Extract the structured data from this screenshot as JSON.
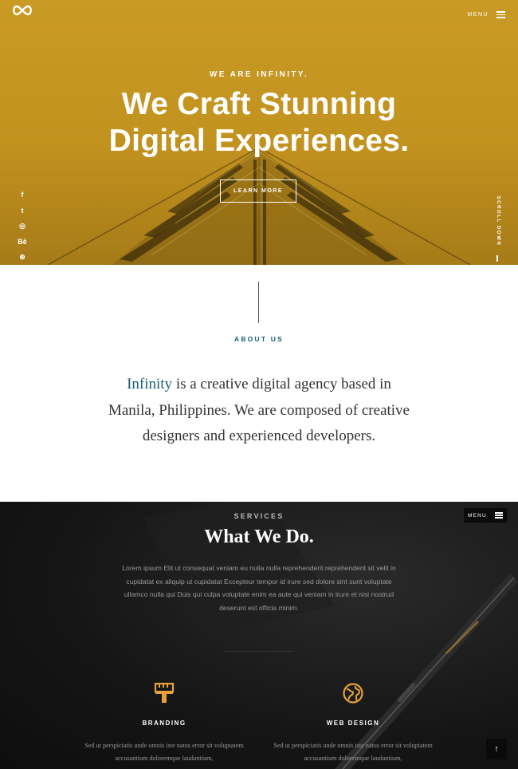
{
  "header": {
    "menu_label": "MENU",
    "logo_icon": "infinity-icon"
  },
  "hero": {
    "eyebrow": "WE ARE INFINITY.",
    "headline_line1": "We Craft Stunning",
    "headline_line2": "Digital Experiences.",
    "cta_label": "LEARN MORE",
    "scroll_label": "SCROLL DOWN",
    "social": [
      {
        "icon": "facebook-icon",
        "glyph": "f"
      },
      {
        "icon": "twitter-icon",
        "glyph": "t"
      },
      {
        "icon": "instagram-icon",
        "glyph": "◎"
      },
      {
        "icon": "behance-icon",
        "glyph": "Bē"
      },
      {
        "icon": "dribbble-icon",
        "glyph": "⊕"
      }
    ]
  },
  "about": {
    "label": "ABOUT US",
    "brand": "Infinity",
    "text": " is a creative digital agency based in Manila, Philippines. We are composed of creative designers and experienced developers."
  },
  "services": {
    "label": "SERVICES",
    "title": "What We Do.",
    "description": "Lorem ipsum Elit ut consequat veniam eu nulla nulla reprehenderit reprehenderit sit velit in cupidatat ex aliquip ut cupidatat Excepteur tempor id irure sed dolore sint sunt voluptate ullamco nulla qui Duis qui culpa voluptate enim ea aute qui veniam in irure et nisi nostrud deserunt est officia minim.",
    "menu_label": "MENU",
    "items": [
      {
        "icon": "paint-brush-icon",
        "title": "BRANDING",
        "desc": "Sed ut perspiciatis unde omnis iste natus error sit voluptatem accusantium doloremque laudantium,"
      },
      {
        "icon": "globe-icon",
        "title": "WEB DESIGN",
        "desc": "Sed ut perspiciatis unde omnis iste natus error sit voluptatem accusantium doloremque laudantium,"
      }
    ],
    "back_to_top": "↑"
  },
  "colors": {
    "hero_gold": "#c99a24",
    "accent_teal": "#1a5f73",
    "icon_orange": "#e8a13a",
    "dark_bg": "#151515"
  }
}
